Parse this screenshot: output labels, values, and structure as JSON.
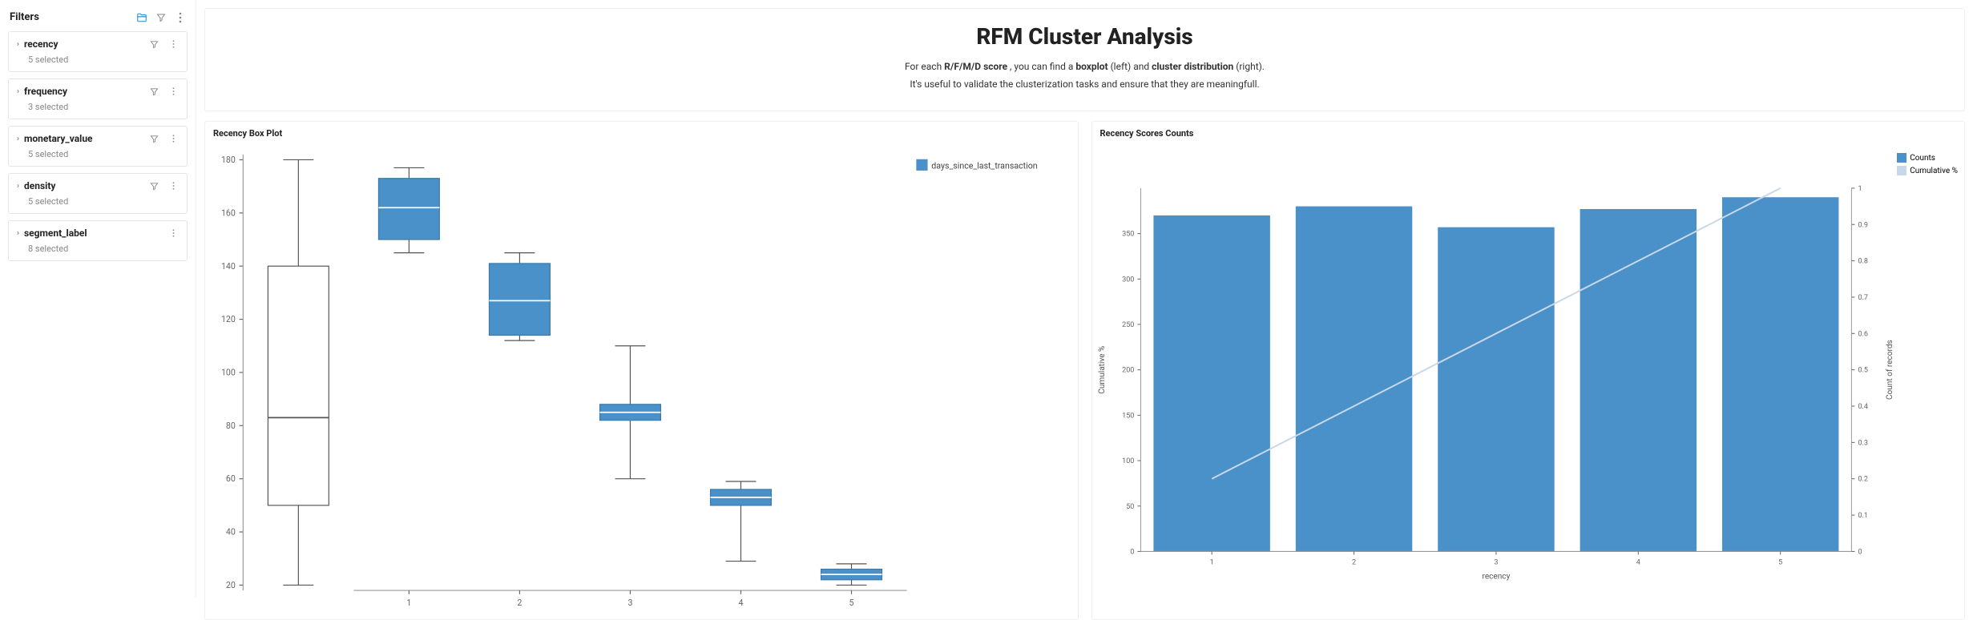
{
  "filters": {
    "title": "Filters",
    "items": [
      {
        "name": "recency",
        "sub": "5 selected",
        "has_funnel": true
      },
      {
        "name": "frequency",
        "sub": "3 selected",
        "has_funnel": true
      },
      {
        "name": "monetary_value",
        "sub": "5 selected",
        "has_funnel": true
      },
      {
        "name": "density",
        "sub": "5 selected",
        "has_funnel": true
      },
      {
        "name": "segment_label",
        "sub": "8 selected",
        "has_funnel": false
      }
    ]
  },
  "hero": {
    "title": "RFM Cluster Analysis",
    "line1_pre": "For each ",
    "line1_b1": "R/F/M/D score",
    "line1_mid1": " , you can find a ",
    "line1_b2": "boxplot",
    "line1_mid2": " (left) and ",
    "line1_b3": "cluster distribution",
    "line1_post": " (right).",
    "line2": "It's useful to validate the clusterization tasks and ensure that they are meaningfull."
  },
  "chart_left": {
    "title": "Recency Box Plot",
    "legend": "days_since_last_transaction"
  },
  "chart_right": {
    "title": "Recency Scores Counts",
    "ylabel": "Cumulative %",
    "xlabel": "recency",
    "y2label": "Count of records",
    "legend1": "Counts",
    "legend2": "Cumulative %"
  },
  "chart_data": [
    {
      "type": "boxplot",
      "title": "Recency Box Plot",
      "series_name": "days_since_last_transaction",
      "categories": [
        "1",
        "2",
        "3",
        "4",
        "5"
      ],
      "y_ticks": [
        20,
        40,
        60,
        80,
        100,
        120,
        140,
        160,
        180
      ],
      "ylim": [
        18,
        182
      ],
      "boxes": [
        {
          "x": "1",
          "min": 20,
          "q1": 50,
          "median": 83,
          "q3": 140,
          "max": 180,
          "style": "outline"
        },
        {
          "x": "2",
          "min": 145,
          "q1": 150,
          "median": 162,
          "q3": 173,
          "max": 177,
          "style": "filled"
        },
        {
          "x": "3",
          "min": 112,
          "q1": 114,
          "median": 127,
          "q3": 141,
          "max": 145,
          "style": "filled"
        },
        {
          "x": "4",
          "min": 60,
          "q1": 82,
          "median": 85,
          "q3": 88,
          "max": 110,
          "style": "filled"
        },
        {
          "x": "5",
          "min": 29,
          "q1": 50,
          "median": 53,
          "q3": 56,
          "max": 59,
          "style": "filled"
        },
        {
          "x": "6",
          "min": 20,
          "q1": 22,
          "median": 24,
          "q3": 26,
          "max": 28,
          "style": "filled"
        }
      ]
    },
    {
      "type": "bar+line",
      "title": "Recency Scores Counts",
      "xlabel": "recency",
      "ylabel_left": "Cumulative %",
      "ylabel_right": "Count of records",
      "categories": [
        "1",
        "2",
        "3",
        "4",
        "5"
      ],
      "y_left_ticks": [
        0,
        50,
        100,
        150,
        200,
        250,
        300,
        350
      ],
      "y_right_ticks": [
        0,
        0.1,
        0.2,
        0.3,
        0.4,
        0.5,
        0.6,
        0.7,
        0.8,
        0.9,
        1
      ],
      "series": [
        {
          "name": "Counts",
          "type": "bar",
          "values": [
            370,
            380,
            357,
            377,
            390
          ]
        },
        {
          "name": "Cumulative %",
          "type": "line",
          "values": [
            0.2,
            0.4,
            0.6,
            0.8,
            1.0
          ]
        }
      ]
    }
  ]
}
